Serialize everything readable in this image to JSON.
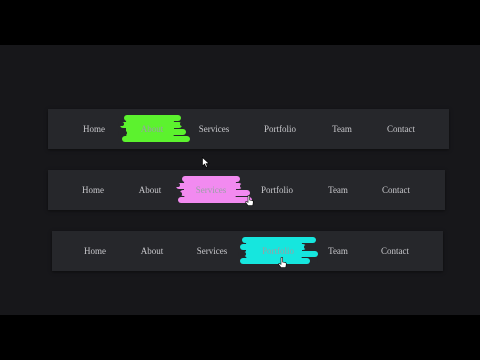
{
  "navbars": [
    {
      "items": [
        "Home",
        "About",
        "Services",
        "Portfolio",
        "Team",
        "Contact"
      ],
      "active_index": 1,
      "highlight_color": "#5cf22e"
    },
    {
      "items": [
        "Home",
        "About",
        "Services",
        "Portfolio",
        "Team",
        "Contact"
      ],
      "active_index": 2,
      "highlight_color": "#f28af0"
    },
    {
      "items": [
        "Home",
        "About",
        "Services",
        "Portfolio",
        "Team",
        "Contact"
      ],
      "active_index": 3,
      "highlight_color": "#16e6de"
    }
  ],
  "icons": {
    "cursor_arrow": "arrow-cursor-icon",
    "cursor_hand": "hand-pointer-icon"
  }
}
